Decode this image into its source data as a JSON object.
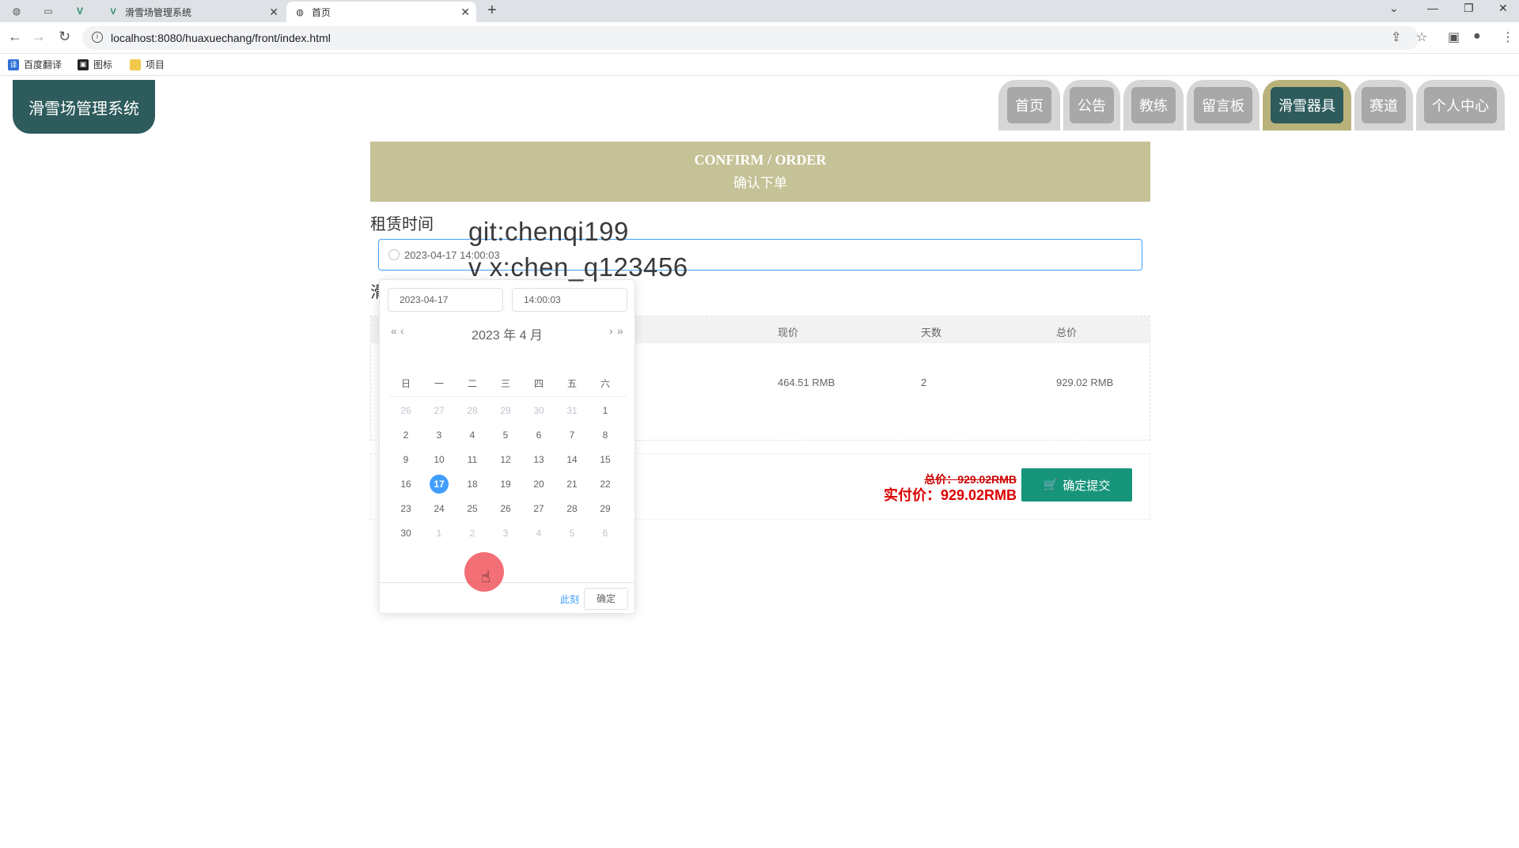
{
  "browser": {
    "tabs": [
      {
        "title": "滑雪场管理系统",
        "icon": "vue-icon"
      },
      {
        "title": "首页",
        "icon": "globe-icon"
      }
    ],
    "url": "localhost:8080/huaxuechang/front/index.html",
    "bookmarks": [
      "百度翻译",
      "图标",
      "项目"
    ]
  },
  "site": {
    "logo": "滑雪场管理系统",
    "nav": [
      "首页",
      "公告",
      "教练",
      "留言板",
      "滑雪器具",
      "赛道",
      "个人中心"
    ],
    "nav_active": "滑雪器具"
  },
  "banner": {
    "title": "CONFIRM / ORDER",
    "subtitle": "确认下单"
  },
  "form": {
    "rent_time_label": "租赁时间",
    "rent_time_value": "2023-04-17 14:00:03",
    "hidden_label": "滑"
  },
  "watermark": {
    "line1": "git:chenqi199",
    "line2": "v x:chen_q123456"
  },
  "table": {
    "columns": [
      "现价",
      "天数",
      "总价"
    ],
    "row": [
      "464.51 RMB",
      "2",
      "929.02 RMB"
    ]
  },
  "summary": {
    "total_old": "总价：929.02RMB",
    "total_real": "实付价：929.02RMB",
    "submit": "确定提交"
  },
  "picker": {
    "date_field": "2023-04-17",
    "time_field": "14:00:03",
    "title": "2023 年  4 月",
    "weekdays": [
      "日",
      "一",
      "二",
      "三",
      "四",
      "五",
      "六"
    ],
    "weeks": [
      [
        "26",
        "27",
        "28",
        "29",
        "30",
        "31",
        "1"
      ],
      [
        "2",
        "3",
        "4",
        "5",
        "6",
        "7",
        "8"
      ],
      [
        "9",
        "10",
        "11",
        "12",
        "13",
        "14",
        "15"
      ],
      [
        "16",
        "17",
        "18",
        "19",
        "20",
        "21",
        "22"
      ],
      [
        "23",
        "24",
        "25",
        "26",
        "27",
        "28",
        "29"
      ],
      [
        "30",
        "1",
        "2",
        "3",
        "4",
        "5",
        "6"
      ]
    ],
    "today": "17",
    "now_label": "此刻",
    "ok_label": "确定"
  },
  "colors": {
    "accent_teal": "#2e5b5b",
    "banner": "#c4c296",
    "submit": "#17957a",
    "price_red": "#d00",
    "picker_blue": "#409eff"
  }
}
